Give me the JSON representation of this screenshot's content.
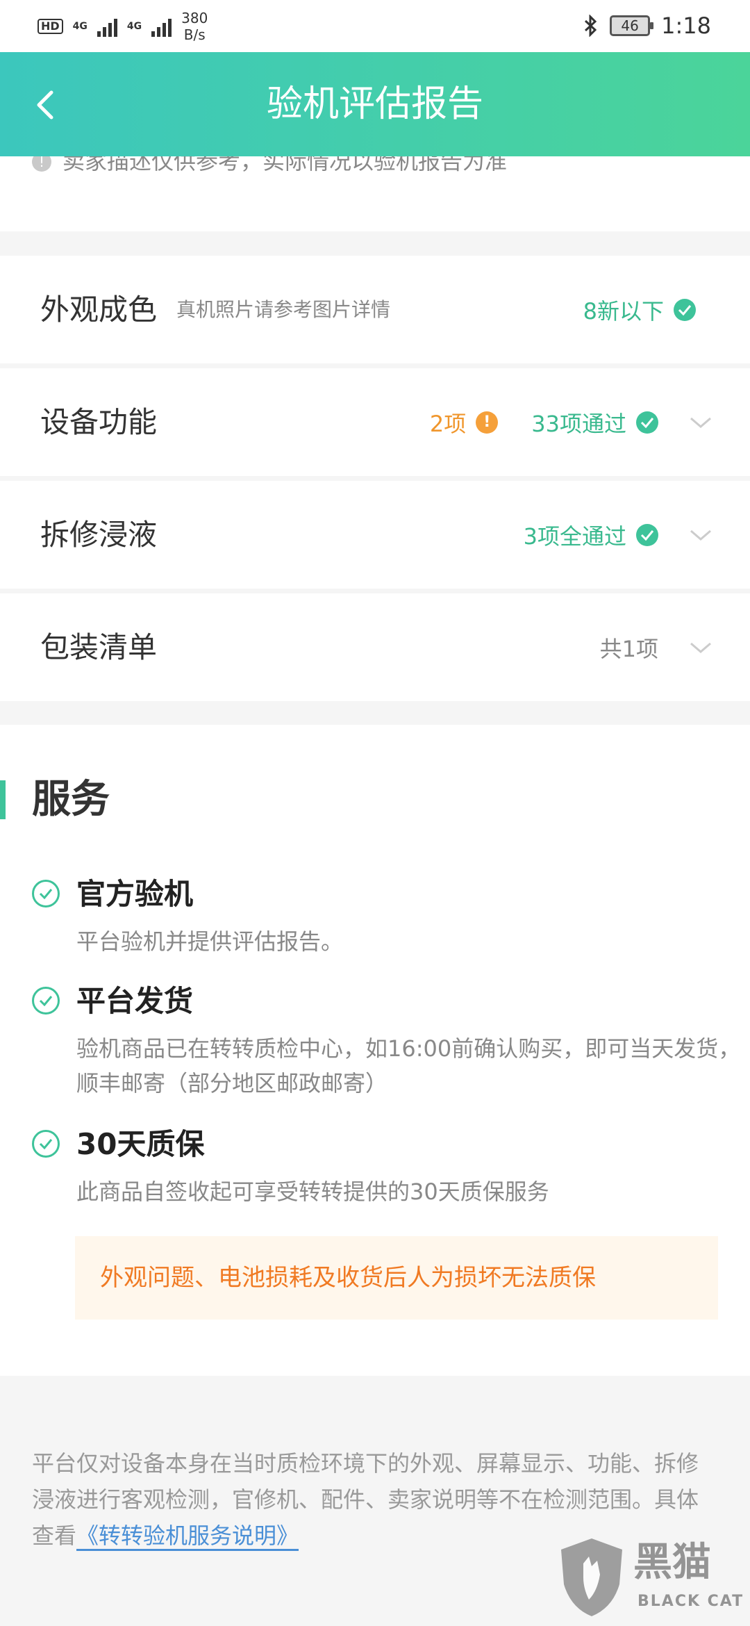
{
  "status_bar": {
    "hd": "HD",
    "net1": "4G",
    "net2": "4G",
    "speed_value": "380",
    "speed_unit": "B/s",
    "battery": "46",
    "time": "1:18"
  },
  "header": {
    "title": "验机评估报告"
  },
  "notice": {
    "text": "卖家描述仅供参考，实际情况以验机报告为准"
  },
  "rows": [
    {
      "label": "外观成色",
      "sub": "真机照片请参考图片详情",
      "status": "8新以下"
    },
    {
      "label": "设备功能",
      "warn": "2项",
      "status": "33项通过"
    },
    {
      "label": "拆修浸液",
      "status": "3项全通过"
    },
    {
      "label": "包装清单",
      "status": "共1项"
    }
  ],
  "service": {
    "title": "服务",
    "items": [
      {
        "name": "官方验机",
        "desc": "平台验机并提供评估报告。"
      },
      {
        "name": "平台发货",
        "desc": "验机商品已在转转质检中心，如16:00前确认购买，即可当天发货，顺丰邮寄（部分地区邮政邮寄）"
      },
      {
        "name": "30天质保",
        "desc": "此商品自签收起可享受转转提供的30天质保服务"
      }
    ],
    "warning": "外观问题、电池损耗及收货后人为损坏无法质保"
  },
  "footer": {
    "text": "平台仅对设备本身在当时质检环境下的外观、屏幕显示、功能、拆修浸液进行客观检测，官修机、配件、卖家说明等不在检测范围。具体查看",
    "link": "《转转验机服务说明》"
  },
  "watermark": {
    "zh": "黑猫",
    "en": "BLACK CAT"
  },
  "colors": {
    "accent": "#3ec39a",
    "warning": "#f0962c",
    "link": "#4a8fd6"
  }
}
